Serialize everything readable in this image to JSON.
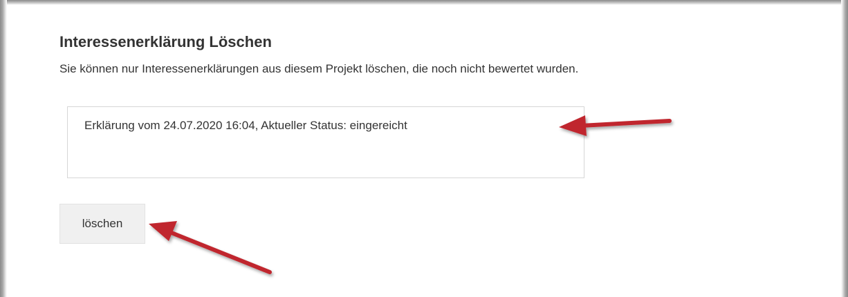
{
  "panel": {
    "title": "Interessenerklärung Löschen",
    "description": "Sie können nur Interessenerklärungen aus diesem Projekt löschen, die noch nicht bewertet wurden."
  },
  "declarations": {
    "items": [
      {
        "label": "Erklärung vom 24.07.2020 16:04,  Aktueller Status: eingereicht"
      }
    ]
  },
  "actions": {
    "delete_label": "löschen"
  },
  "annotations": {
    "arrow_color": "#c0272d"
  }
}
